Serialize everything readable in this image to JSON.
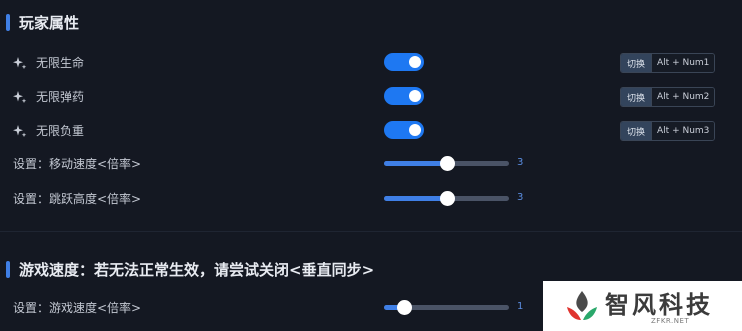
{
  "sections": [
    {
      "title": "玩家属性"
    },
    {
      "title": "游戏速度：若无法正常生效，请尝试关闭<垂直同步>"
    }
  ],
  "toggles": [
    {
      "label": "无限生命",
      "on": true,
      "hotkey_tag": "切换",
      "hotkey": "Alt + Num1"
    },
    {
      "label": "无限弹药",
      "on": true,
      "hotkey_tag": "切换",
      "hotkey": "Alt + Num2"
    },
    {
      "label": "无限负重",
      "on": true,
      "hotkey_tag": "切换",
      "hotkey": "Alt + Num3"
    }
  ],
  "sliders": [
    {
      "label": "设置：移动速度<倍率>",
      "value": "3",
      "fraction": 0.5
    },
    {
      "label": "设置：跳跃高度<倍率>",
      "value": "3",
      "fraction": 0.5
    },
    {
      "label": "设置：游戏速度<倍率>",
      "value": "1",
      "fraction": 0.16
    }
  ],
  "watermark": {
    "brand": "智风科技",
    "domain": "ZFKR.NET"
  },
  "colors": {
    "background": "#141822",
    "accent": "#1e78f2",
    "slider_fill": "#3f7fe6",
    "slider_track": "#4a5366"
  },
  "icons": {
    "feature": "sparkle-icon",
    "logo": "leaf-logo-icon"
  }
}
